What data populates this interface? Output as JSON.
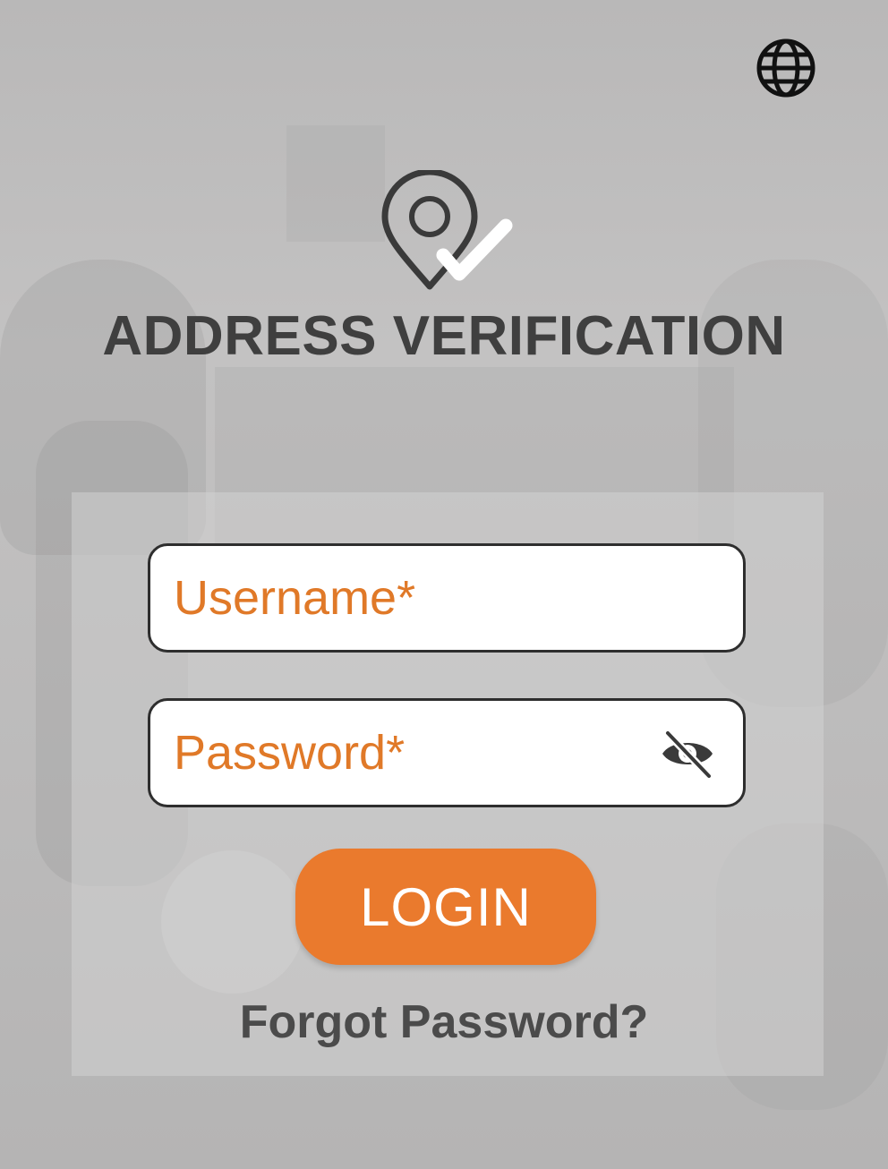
{
  "header": {
    "language_icon": "globe-icon"
  },
  "logo": {
    "icon": "location-pin-check-icon"
  },
  "app": {
    "title": "ADDRESS VERIFICATION"
  },
  "form": {
    "username": {
      "placeholder": "Username*",
      "value": ""
    },
    "password": {
      "placeholder": "Password*",
      "value": "",
      "toggle_icon": "eye-off-icon"
    },
    "login_label": "LOGIN",
    "forgot_label": "Forgot Password?"
  },
  "colors": {
    "accent": "#ea7a2d",
    "placeholder": "#e07928",
    "title": "#3f3f3f",
    "background": "#bdbcbc"
  }
}
